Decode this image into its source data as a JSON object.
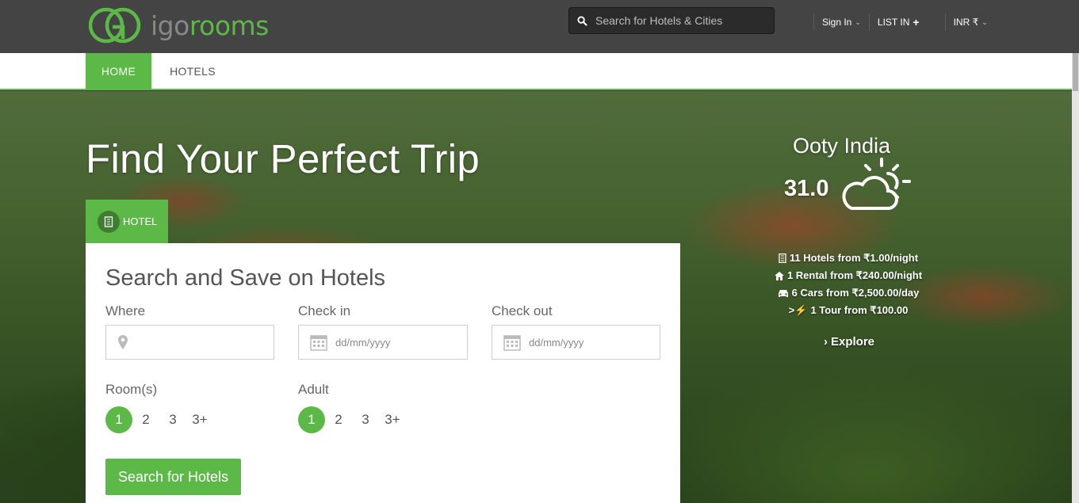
{
  "brand": {
    "name_pre": "igo",
    "name_post": "rooms",
    "accent": "#5cb947"
  },
  "header": {
    "search_placeholder": "Search for Hotels & Cities",
    "sign_in": "Sign In",
    "list_in": "LIST IN",
    "currency": "INR ₹"
  },
  "nav": {
    "home": "HOME",
    "hotels": "HOTELS"
  },
  "hero": {
    "title": "Find Your Perfect Trip"
  },
  "tab": {
    "hotel": "HOTEL"
  },
  "form": {
    "title": "Search and Save on Hotels",
    "where_label": "Where",
    "where_value": "",
    "checkin_label": "Check in",
    "checkin_placeholder": "dd/mm/yyyy",
    "checkout_label": "Check out",
    "checkout_placeholder": "dd/mm/yyyy",
    "rooms_label": "Room(s)",
    "rooms_options": [
      "1",
      "2",
      "3",
      "3+"
    ],
    "rooms_selected": "1",
    "adult_label": "Adult",
    "adult_options": [
      "1",
      "2",
      "3",
      "3+"
    ],
    "adult_selected": "1",
    "submit": "Search for Hotels"
  },
  "weather": {
    "city": "Ooty India",
    "temperature": "31.0",
    "icon": "partly-cloudy-icon"
  },
  "stats": [
    {
      "icon": "building-icon",
      "text": "11 Hotels from ₹1.00/night"
    },
    {
      "icon": "home-icon",
      "text": "1 Rental from ₹240.00/night"
    },
    {
      "icon": "car-icon",
      "text": "6 Cars from ₹2,500.00/day"
    },
    {
      "icon": "bolt-icon",
      "text": "1 Tour from ₹100.00"
    }
  ],
  "explore": "Explore"
}
